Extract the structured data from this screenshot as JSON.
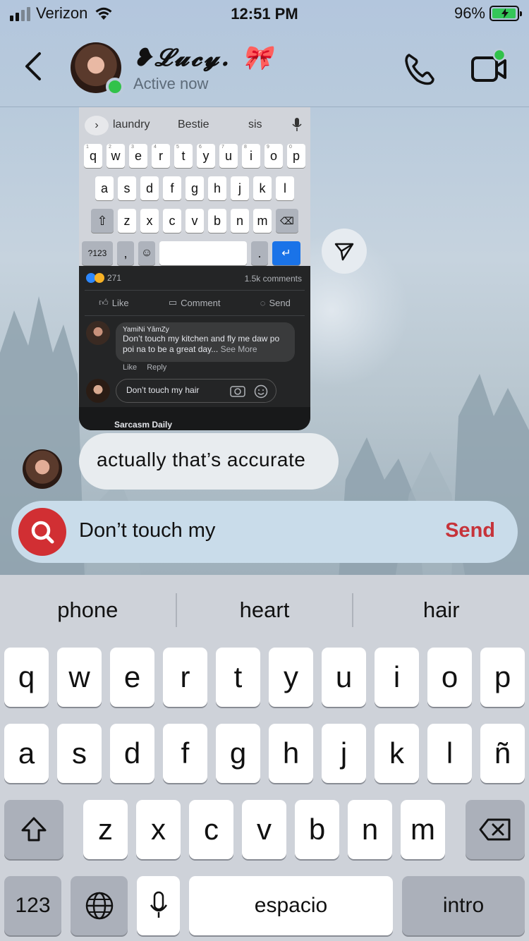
{
  "status_bar": {
    "carrier": "Verizon",
    "time": "12:51 PM",
    "battery": "96%"
  },
  "header": {
    "contact_name": "❥𝓛𝓾𝓬𝔂. 🎀",
    "status": "Active now"
  },
  "shared_image": {
    "keyboard": {
      "suggestions": [
        "laundry",
        "Bestie",
        "sis"
      ],
      "row1": [
        "q",
        "w",
        "e",
        "r",
        "t",
        "y",
        "u",
        "i",
        "o",
        "p"
      ],
      "row1_nums": [
        "1",
        "2",
        "3",
        "4",
        "5",
        "6",
        "7",
        "8",
        "9",
        "0"
      ],
      "row2": [
        "a",
        "s",
        "d",
        "f",
        "g",
        "h",
        "j",
        "k",
        "l"
      ],
      "row3": [
        "z",
        "x",
        "c",
        "v",
        "b",
        "n",
        "m"
      ],
      "mode_key": "?123",
      "comma": ","
    },
    "facebook": {
      "reactions": "271",
      "comments": "1.5k comments",
      "actions": [
        "Like",
        "Comment",
        "Send"
      ],
      "comment_author": "YamiNi YâmZy",
      "comment_text": "Don’t touch my kitchen and fly me daw po poi na to be a great day...",
      "see_more": "See More",
      "comment_like": "Like",
      "comment_reply": "Reply",
      "reply_input": "Don’t touch my hair",
      "next_page": "Sarcasm Daily"
    }
  },
  "message": {
    "text": "actually that’s accurate"
  },
  "composer": {
    "value": "Don’t touch my",
    "send_label": "Send"
  },
  "keyboard": {
    "predictions": [
      "phone",
      "heart",
      "hair"
    ],
    "row1": [
      "q",
      "w",
      "e",
      "r",
      "t",
      "y",
      "u",
      "i",
      "o",
      "p"
    ],
    "row2": [
      "a",
      "s",
      "d",
      "f",
      "g",
      "h",
      "j",
      "k",
      "l",
      "ñ"
    ],
    "row3": [
      "z",
      "x",
      "c",
      "v",
      "b",
      "n",
      "m"
    ],
    "numbers_key": "123",
    "space_key": "espacio",
    "return_key": "intro"
  },
  "colors": {
    "accent_red": "#c6333a",
    "online_green": "#31c24a",
    "battery_green": "#34c759"
  }
}
